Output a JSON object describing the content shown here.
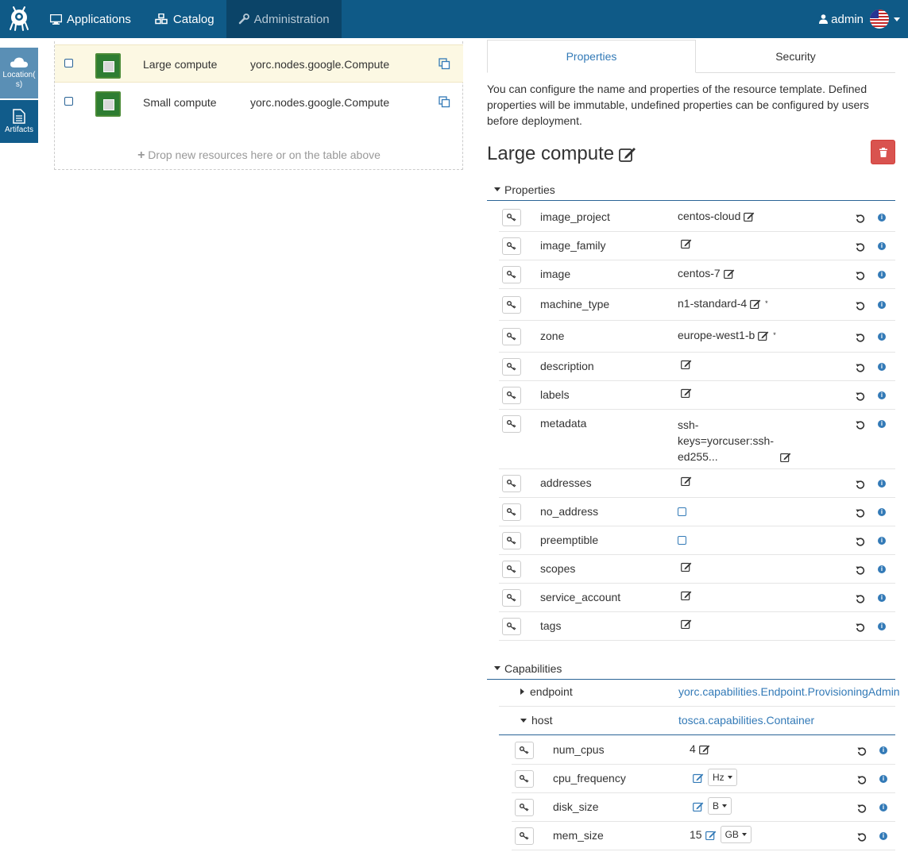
{
  "nav": {
    "applications": "Applications",
    "catalog": "Catalog",
    "administration": "Administration",
    "user": "admin"
  },
  "rail": {
    "location": "Location(\ns)",
    "artifacts": "Artifacts"
  },
  "resources": {
    "rows": [
      {
        "name": "Large compute",
        "type": "yorc.nodes.google.Compute"
      },
      {
        "name": "Small compute",
        "type": "yorc.nodes.google.Compute"
      }
    ],
    "drop_hint": "Drop new resources here or on the table above"
  },
  "tabs": {
    "properties": "Properties",
    "security": "Security"
  },
  "description": "You can configure the name and properties of the resource template. Defined properties will be immutable, undefined properties can be configured by users before deployment.",
  "title": "Large compute",
  "sections": {
    "properties": "Properties",
    "capabilities": "Capabilities"
  },
  "properties": [
    {
      "name": "image_project",
      "value": "centos-cloud"
    },
    {
      "name": "image_family",
      "value": ""
    },
    {
      "name": "image",
      "value": "centos-7"
    },
    {
      "name": "machine_type",
      "value": "n1-standard-4",
      "star": "*"
    },
    {
      "name": "zone",
      "value": "europe-west1-b",
      "star": "*"
    },
    {
      "name": "description",
      "value": ""
    },
    {
      "name": "labels",
      "value": ""
    },
    {
      "name": "metadata",
      "value_lines": [
        "ssh-",
        "keys=yorcuser:ssh-",
        "ed255..."
      ]
    },
    {
      "name": "addresses",
      "value": ""
    },
    {
      "name": "no_address",
      "checkbox": true
    },
    {
      "name": "preemptible",
      "checkbox": true
    },
    {
      "name": "scopes",
      "value": ""
    },
    {
      "name": "service_account",
      "value": ""
    },
    {
      "name": "tags",
      "value": ""
    }
  ],
  "capabilities": [
    {
      "name": "endpoint",
      "type": "yorc.capabilities.Endpoint.ProvisioningAdmin",
      "expanded": false
    },
    {
      "name": "host",
      "type": "tosca.capabilities.Container",
      "expanded": true
    }
  ],
  "host_properties": [
    {
      "name": "num_cpus",
      "value": "4"
    },
    {
      "name": "cpu_frequency",
      "value": "",
      "unit": "Hz"
    },
    {
      "name": "disk_size",
      "value": "",
      "unit": "B"
    },
    {
      "name": "mem_size",
      "value": "15",
      "unit": "GB"
    }
  ],
  "colors": {
    "topbar": "#0f5a87",
    "accent": "#337ab7",
    "danger": "#d9534f",
    "selected_row": "#fcf8e3"
  }
}
